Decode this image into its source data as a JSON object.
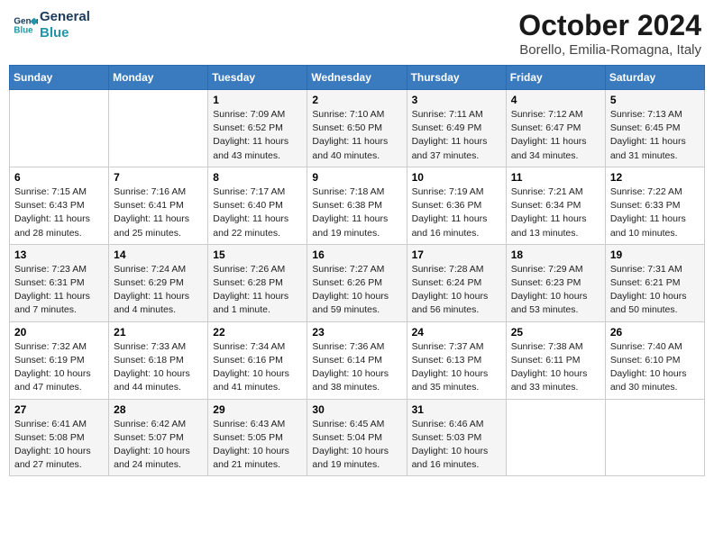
{
  "logo": {
    "line1": "General",
    "line2": "Blue"
  },
  "title": "October 2024",
  "subtitle": "Borello, Emilia-Romagna, Italy",
  "weekdays": [
    "Sunday",
    "Monday",
    "Tuesday",
    "Wednesday",
    "Thursday",
    "Friday",
    "Saturday"
  ],
  "weeks": [
    [
      {
        "day": "",
        "detail": ""
      },
      {
        "day": "",
        "detail": ""
      },
      {
        "day": "1",
        "detail": "Sunrise: 7:09 AM\nSunset: 6:52 PM\nDaylight: 11 hours and 43 minutes."
      },
      {
        "day": "2",
        "detail": "Sunrise: 7:10 AM\nSunset: 6:50 PM\nDaylight: 11 hours and 40 minutes."
      },
      {
        "day": "3",
        "detail": "Sunrise: 7:11 AM\nSunset: 6:49 PM\nDaylight: 11 hours and 37 minutes."
      },
      {
        "day": "4",
        "detail": "Sunrise: 7:12 AM\nSunset: 6:47 PM\nDaylight: 11 hours and 34 minutes."
      },
      {
        "day": "5",
        "detail": "Sunrise: 7:13 AM\nSunset: 6:45 PM\nDaylight: 11 hours and 31 minutes."
      }
    ],
    [
      {
        "day": "6",
        "detail": "Sunrise: 7:15 AM\nSunset: 6:43 PM\nDaylight: 11 hours and 28 minutes."
      },
      {
        "day": "7",
        "detail": "Sunrise: 7:16 AM\nSunset: 6:41 PM\nDaylight: 11 hours and 25 minutes."
      },
      {
        "day": "8",
        "detail": "Sunrise: 7:17 AM\nSunset: 6:40 PM\nDaylight: 11 hours and 22 minutes."
      },
      {
        "day": "9",
        "detail": "Sunrise: 7:18 AM\nSunset: 6:38 PM\nDaylight: 11 hours and 19 minutes."
      },
      {
        "day": "10",
        "detail": "Sunrise: 7:19 AM\nSunset: 6:36 PM\nDaylight: 11 hours and 16 minutes."
      },
      {
        "day": "11",
        "detail": "Sunrise: 7:21 AM\nSunset: 6:34 PM\nDaylight: 11 hours and 13 minutes."
      },
      {
        "day": "12",
        "detail": "Sunrise: 7:22 AM\nSunset: 6:33 PM\nDaylight: 11 hours and 10 minutes."
      }
    ],
    [
      {
        "day": "13",
        "detail": "Sunrise: 7:23 AM\nSunset: 6:31 PM\nDaylight: 11 hours and 7 minutes."
      },
      {
        "day": "14",
        "detail": "Sunrise: 7:24 AM\nSunset: 6:29 PM\nDaylight: 11 hours and 4 minutes."
      },
      {
        "day": "15",
        "detail": "Sunrise: 7:26 AM\nSunset: 6:28 PM\nDaylight: 11 hours and 1 minute."
      },
      {
        "day": "16",
        "detail": "Sunrise: 7:27 AM\nSunset: 6:26 PM\nDaylight: 10 hours and 59 minutes."
      },
      {
        "day": "17",
        "detail": "Sunrise: 7:28 AM\nSunset: 6:24 PM\nDaylight: 10 hours and 56 minutes."
      },
      {
        "day": "18",
        "detail": "Sunrise: 7:29 AM\nSunset: 6:23 PM\nDaylight: 10 hours and 53 minutes."
      },
      {
        "day": "19",
        "detail": "Sunrise: 7:31 AM\nSunset: 6:21 PM\nDaylight: 10 hours and 50 minutes."
      }
    ],
    [
      {
        "day": "20",
        "detail": "Sunrise: 7:32 AM\nSunset: 6:19 PM\nDaylight: 10 hours and 47 minutes."
      },
      {
        "day": "21",
        "detail": "Sunrise: 7:33 AM\nSunset: 6:18 PM\nDaylight: 10 hours and 44 minutes."
      },
      {
        "day": "22",
        "detail": "Sunrise: 7:34 AM\nSunset: 6:16 PM\nDaylight: 10 hours and 41 minutes."
      },
      {
        "day": "23",
        "detail": "Sunrise: 7:36 AM\nSunset: 6:14 PM\nDaylight: 10 hours and 38 minutes."
      },
      {
        "day": "24",
        "detail": "Sunrise: 7:37 AM\nSunset: 6:13 PM\nDaylight: 10 hours and 35 minutes."
      },
      {
        "day": "25",
        "detail": "Sunrise: 7:38 AM\nSunset: 6:11 PM\nDaylight: 10 hours and 33 minutes."
      },
      {
        "day": "26",
        "detail": "Sunrise: 7:40 AM\nSunset: 6:10 PM\nDaylight: 10 hours and 30 minutes."
      }
    ],
    [
      {
        "day": "27",
        "detail": "Sunrise: 6:41 AM\nSunset: 5:08 PM\nDaylight: 10 hours and 27 minutes."
      },
      {
        "day": "28",
        "detail": "Sunrise: 6:42 AM\nSunset: 5:07 PM\nDaylight: 10 hours and 24 minutes."
      },
      {
        "day": "29",
        "detail": "Sunrise: 6:43 AM\nSunset: 5:05 PM\nDaylight: 10 hours and 21 minutes."
      },
      {
        "day": "30",
        "detail": "Sunrise: 6:45 AM\nSunset: 5:04 PM\nDaylight: 10 hours and 19 minutes."
      },
      {
        "day": "31",
        "detail": "Sunrise: 6:46 AM\nSunset: 5:03 PM\nDaylight: 10 hours and 16 minutes."
      },
      {
        "day": "",
        "detail": ""
      },
      {
        "day": "",
        "detail": ""
      }
    ]
  ]
}
